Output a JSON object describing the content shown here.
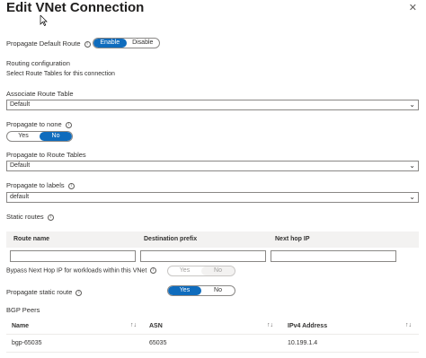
{
  "header": {
    "title": "Edit VNet Connection"
  },
  "propagate_default_route": {
    "label": "Propagate Default Route",
    "options": [
      "Enable",
      "Disable"
    ],
    "selected": "Enable"
  },
  "routing": {
    "heading": "Routing configuration",
    "subtext": "Select Route Tables for this connection"
  },
  "associate_route_table": {
    "label": "Associate Route Table",
    "value": "Default"
  },
  "propagate_to_none": {
    "label": "Propagate to none",
    "options": [
      "Yes",
      "No"
    ],
    "selected": "No"
  },
  "propagate_to_route_tables": {
    "label": "Propagate to Route Tables",
    "value": "Default"
  },
  "propagate_to_labels": {
    "label": "Propagate to labels",
    "value": "default"
  },
  "static_routes": {
    "label": "Static routes",
    "columns": [
      "Route name",
      "Destination prefix",
      "Next hop IP"
    ]
  },
  "bypass_next_hop": {
    "label": "Bypass Next Hop IP for workloads within this VNet",
    "options": [
      "Yes",
      "No"
    ],
    "selected": "No",
    "disabled": true
  },
  "propagate_static_route": {
    "label": "Propagate static route",
    "options": [
      "Yes",
      "No"
    ],
    "selected": "Yes"
  },
  "bgp_peers": {
    "label": "BGP Peers",
    "columns": [
      "Name",
      "ASN",
      "IPv4 Address"
    ],
    "rows": [
      {
        "name": "bgp-65035",
        "asn": "65035",
        "ipv4": "10.199.1.4"
      }
    ]
  },
  "colors": {
    "accent": "#0f6cbd",
    "border": "#8a8886",
    "header_bg": "#f3f2f1"
  }
}
